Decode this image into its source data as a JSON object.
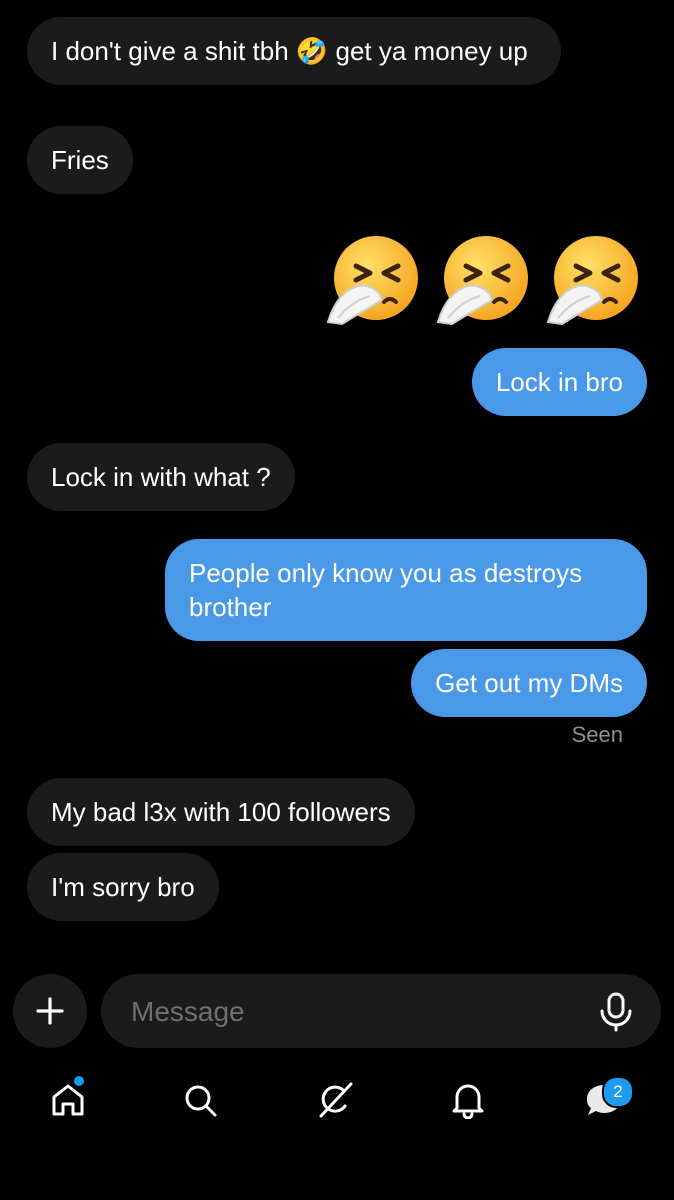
{
  "messages": [
    {
      "direction": "incoming",
      "text": "I don't give a shit tbh 🤣 get ya money up"
    },
    {
      "direction": "incoming",
      "text": "Fries"
    },
    {
      "direction": "outgoing",
      "type": "emoji",
      "emoji_names": [
        "sneezing-face-emoji",
        "sneezing-face-emoji",
        "sneezing-face-emoji"
      ]
    },
    {
      "direction": "outgoing",
      "text": "Lock in bro"
    },
    {
      "direction": "incoming",
      "text": "Lock in with what ?"
    },
    {
      "direction": "outgoing",
      "text": "People only know you as destroys brother"
    },
    {
      "direction": "outgoing",
      "text": "Get out my DMs"
    },
    {
      "direction": "incoming",
      "text": "My bad l3x with 100 followers"
    },
    {
      "direction": "incoming",
      "text": "I'm sorry bro"
    }
  ],
  "seen_label": "Seen",
  "compose": {
    "placeholder": "Message",
    "add_icon": "plus-icon",
    "mic_icon": "microphone-icon"
  },
  "nav": {
    "items": [
      "home-icon",
      "search-icon",
      "grok-icon",
      "notifications-bell-icon",
      "messages-icon"
    ],
    "messages_badge": "2"
  },
  "colors": {
    "background": "#000000",
    "incoming_bubble": "#1b1b1b",
    "outgoing_bubble": "#4a99e9",
    "badge": "#1d9bf0"
  }
}
